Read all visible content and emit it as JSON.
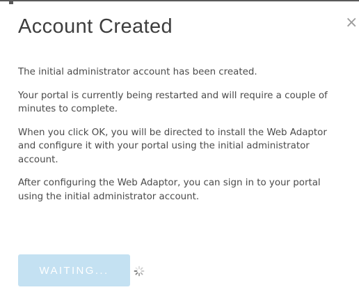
{
  "dialog": {
    "title": "Account Created",
    "close_glyph": "×",
    "paragraphs": [
      "The initial administrator account has been created.",
      "Your portal is currently being restarted and will require a couple of minutes to complete.",
      "When you click OK, you will be directed to install the Web Adaptor and configure it with your portal using the initial administrator account.",
      "After configuring the Web Adaptor, you can sign in to your portal using the initial administrator account."
    ],
    "waiting_button_label": "WAITING...",
    "spinner_icon": "loading-spinner-icon"
  },
  "colors": {
    "button_disabled_bg": "#c4e1f2",
    "button_text": "#ffffff",
    "title_text": "#3d3d3d",
    "body_text": "#4a4a4a",
    "close_icon": "#9c9c9c"
  }
}
